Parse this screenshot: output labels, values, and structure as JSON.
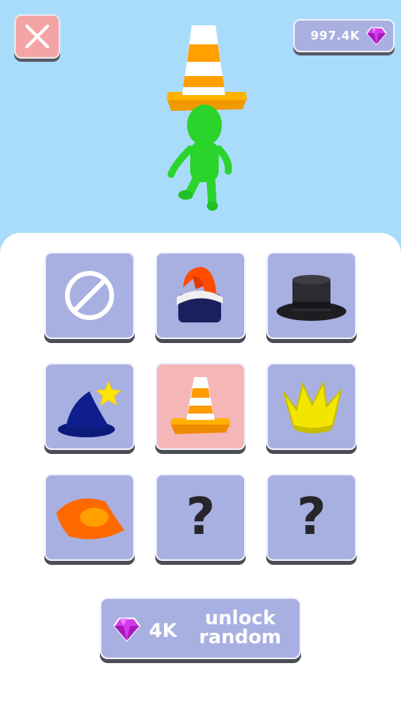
{
  "header": {
    "gem_count": "997.4K",
    "close_icon": "close-x-icon",
    "gem_icon": "purple-gem-icon"
  },
  "character": {
    "equipped_hat": "traffic-cone-hat",
    "body_color": "#2bd42b"
  },
  "hats": [
    {
      "id": "none",
      "icon": "none-icon",
      "locked": false,
      "selected": false
    },
    {
      "id": "beanie",
      "icon": "beanie-icon",
      "locked": false,
      "selected": false
    },
    {
      "id": "top-hat",
      "icon": "top-hat-icon",
      "locked": false,
      "selected": false
    },
    {
      "id": "wizard-hat",
      "icon": "wizard-hat-icon",
      "locked": false,
      "selected": false
    },
    {
      "id": "traffic-cone",
      "icon": "traffic-cone-icon",
      "locked": false,
      "selected": true
    },
    {
      "id": "crown",
      "icon": "crown-icon",
      "locked": false,
      "selected": false
    },
    {
      "id": "sun-hat",
      "icon": "sun-hat-icon",
      "locked": false,
      "selected": false
    },
    {
      "id": "locked-1",
      "label": "?",
      "locked": true,
      "selected": false
    },
    {
      "id": "locked-2",
      "label": "?",
      "locked": true,
      "selected": false
    }
  ],
  "unlock_button": {
    "cost": "4K",
    "label_line1": "unlock",
    "label_line2": "random"
  },
  "colors": {
    "sky": "#a9dcfb",
    "tile": "#a8b0e2",
    "tile_selected": "#f5b6b8",
    "close_button": "#f5a4a6",
    "gem": "#c21fd6"
  }
}
